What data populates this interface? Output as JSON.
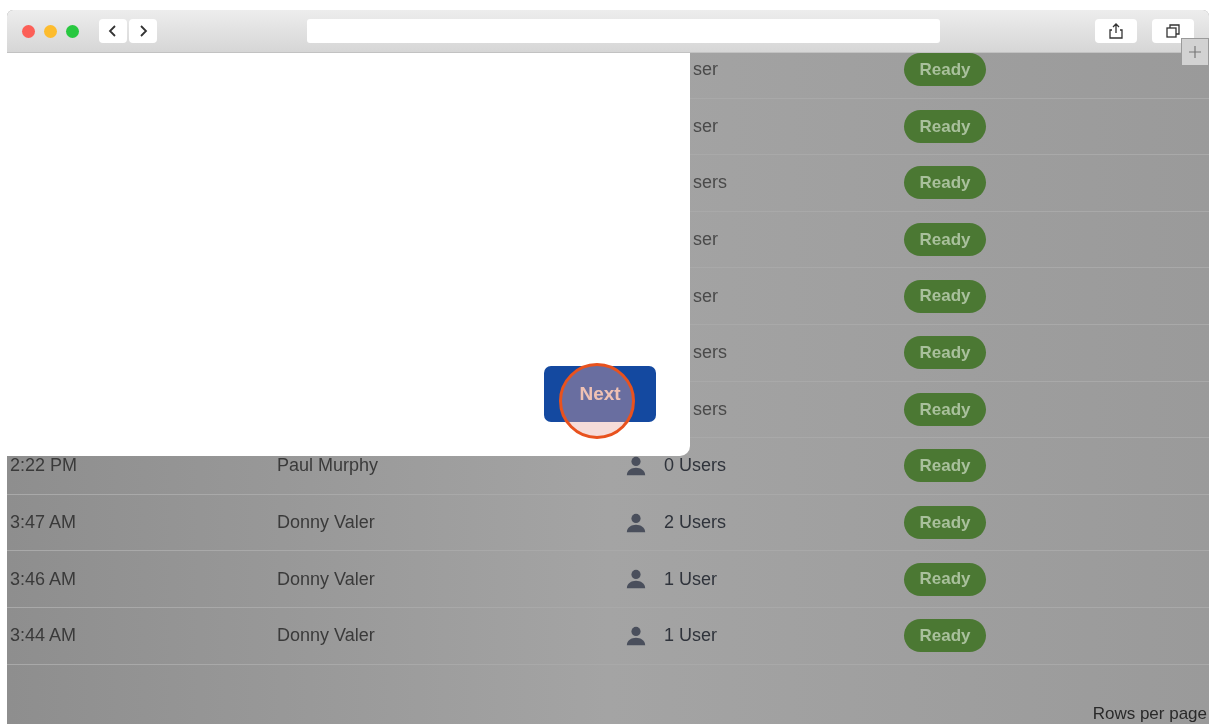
{
  "rows": [
    {
      "kind": "covered",
      "users": "ser",
      "status": "Ready"
    },
    {
      "kind": "covered",
      "users": "ser",
      "status": "Ready"
    },
    {
      "kind": "covered",
      "users": "sers",
      "status": "Ready"
    },
    {
      "kind": "covered",
      "users": "ser",
      "status": "Ready"
    },
    {
      "kind": "covered",
      "users": "ser",
      "status": "Ready"
    },
    {
      "kind": "covered",
      "users": "sers",
      "status": "Ready"
    },
    {
      "kind": "covered",
      "users": "sers",
      "status": "Ready"
    },
    {
      "kind": "full",
      "time": "2:22 PM",
      "name": "Paul Murphy",
      "users": "0 Users",
      "status": "Ready"
    },
    {
      "kind": "full",
      "time": "3:47 AM",
      "name": "Donny Valer",
      "users": "2 Users",
      "status": "Ready"
    },
    {
      "kind": "full",
      "time": "3:46 AM",
      "name": "Donny Valer",
      "users": "1 User",
      "status": "Ready"
    },
    {
      "kind": "full",
      "time": "3:44 AM",
      "name": "Donny Valer",
      "users": "1 User",
      "status": "Ready"
    }
  ],
  "dialog": {
    "button": "Next",
    "highlighted": true
  },
  "footer": {
    "rows_per_page": "Rows per page"
  }
}
